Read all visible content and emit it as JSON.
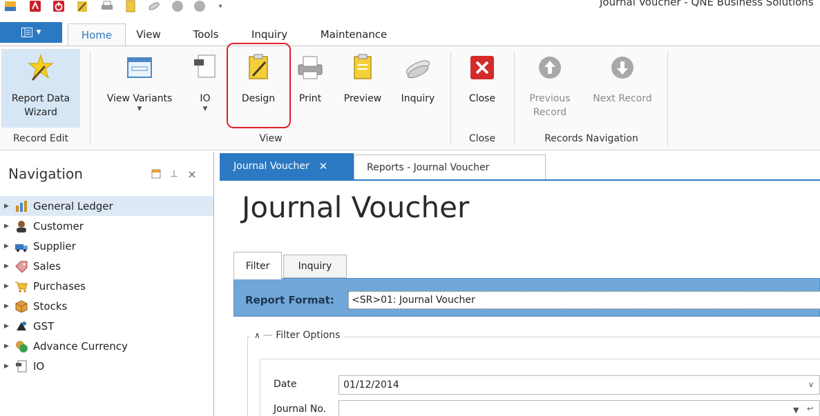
{
  "window": {
    "title": "Journal Voucher - QNE Business Solutions"
  },
  "qat": {
    "icons": [
      "app-logo-icon",
      "pdf-icon",
      "power-icon",
      "design-icon",
      "print-icon",
      "preview-icon",
      "inquiry-icon",
      "back-icon",
      "forward-icon",
      "customize-icon"
    ]
  },
  "ribbon": {
    "tabs": [
      "Home",
      "View",
      "Tools",
      "Inquiry",
      "Maintenance"
    ],
    "active_tab": "Home",
    "file_glyph": "▼",
    "groups": {
      "record_edit": "Record Edit",
      "view": "View",
      "close": "Close",
      "records_navigation": "Records Navigation"
    },
    "buttons": {
      "report_data_wizard_1": "Report Data",
      "report_data_wizard_2": "Wizard",
      "view_variants": "View Variants",
      "io": "IO",
      "design": "Design",
      "print": "Print",
      "preview": "Preview",
      "inquiry": "Inquiry",
      "close": "Close",
      "previous_record_1": "Previous",
      "previous_record_2": "Record",
      "next_record": "Next Record"
    }
  },
  "navigation": {
    "title": "Navigation",
    "items": [
      {
        "label": "General Ledger",
        "icon": "general-ledger-icon"
      },
      {
        "label": "Customer",
        "icon": "customer-icon"
      },
      {
        "label": "Supplier",
        "icon": "supplier-icon"
      },
      {
        "label": "Sales",
        "icon": "sales-icon"
      },
      {
        "label": "Purchases",
        "icon": "purchases-icon"
      },
      {
        "label": "Stocks",
        "icon": "stocks-icon"
      },
      {
        "label": "GST",
        "icon": "gst-icon"
      },
      {
        "label": "Advance Currency",
        "icon": "advance-currency-icon"
      },
      {
        "label": "IO",
        "icon": "io-icon"
      }
    ]
  },
  "document": {
    "tabs": [
      "Journal Voucher",
      "Reports - Journal Voucher"
    ],
    "title": "Journal Voucher",
    "inner_tabs": [
      "Filter",
      "Inquiry"
    ],
    "report_format_label": "Report Format:",
    "report_format_value": "<SR>01: Journal Voucher",
    "filter_options_title": "Filter Options",
    "fields": {
      "date_label": "Date",
      "date_value": "01/12/2014",
      "journal_no_label": "Journal No.",
      "journal_no_value": ""
    }
  },
  "colors": {
    "accent": "#2b79c2",
    "report_bar": "#6fa7d8",
    "highlight": "#e0202a"
  }
}
